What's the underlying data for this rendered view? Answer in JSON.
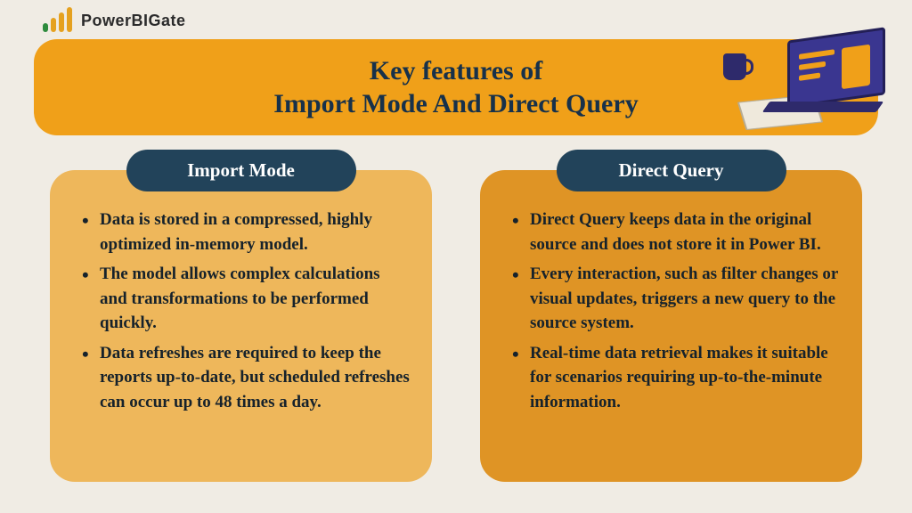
{
  "brand": {
    "name": "PowerBIGate"
  },
  "banner": {
    "line1": "Key features of",
    "line2": "Import Mode And Direct Query"
  },
  "columns": {
    "import": {
      "title": "Import Mode",
      "bullets": [
        "Data is stored in a compressed, highly optimized in-memory model.",
        "The model allows complex calculations and transformations to be performed quickly.",
        "Data refreshes are required to keep the reports up-to-date, but scheduled refreshes can occur up to 48 times a day."
      ]
    },
    "directquery": {
      "title": "Direct Query",
      "bullets": [
        "Direct Query keeps data in the original source and does not store it in Power BI.",
        "Every interaction, such as filter changes or visual updates, triggers a new query to the source system.",
        "Real-time data retrieval makes it suitable for scenarios requiring up-to-the-minute information."
      ]
    }
  }
}
